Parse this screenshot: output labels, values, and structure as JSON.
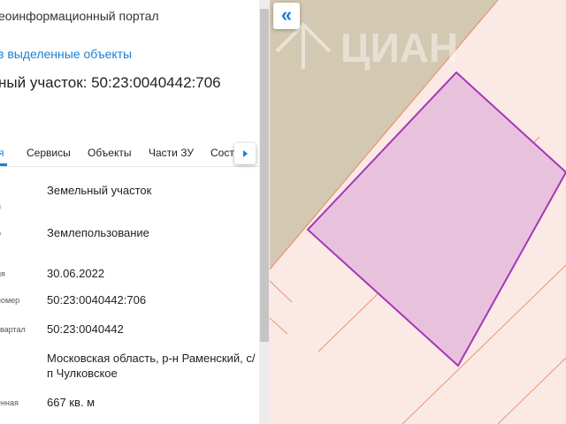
{
  "panel": {
    "portal_title": "еоинформационный портал",
    "link_text": "в выделенные объекты",
    "object_title": "ный участок: 50:23:0040442:706"
  },
  "tabs": [
    {
      "label": "я",
      "active": true
    },
    {
      "label": "Сервисы",
      "active": false
    },
    {
      "label": "Объекты",
      "active": false
    },
    {
      "label": "Части ЗУ",
      "active": false
    },
    {
      "label": "Соста",
      "active": false
    }
  ],
  "rows": [
    {
      "label": "н",
      "value": "Земельный участок"
    },
    {
      "label": "о",
      "value": "Землепользование"
    },
    {
      "label": "ия",
      "value": "30.06.2022"
    },
    {
      "label": "номер",
      "value": "50:23:0040442:706"
    },
    {
      "label": "квартал",
      "value": "50:23:0040442"
    },
    {
      "label": "",
      "value": "Московская область, р-н Раменский, с/п Чулковское"
    },
    {
      "label": "енная",
      "value": "667 кв. м"
    }
  ],
  "map": {
    "collapse_label": "«",
    "watermark_text": "ЦИАН",
    "colors": {
      "background": "#fbe9e5",
      "gray_parcel": "#d3c8b1",
      "selected_fill": "#e8c2dd",
      "selected_stroke": "#a437b8",
      "boundary": "#e8966f"
    }
  }
}
